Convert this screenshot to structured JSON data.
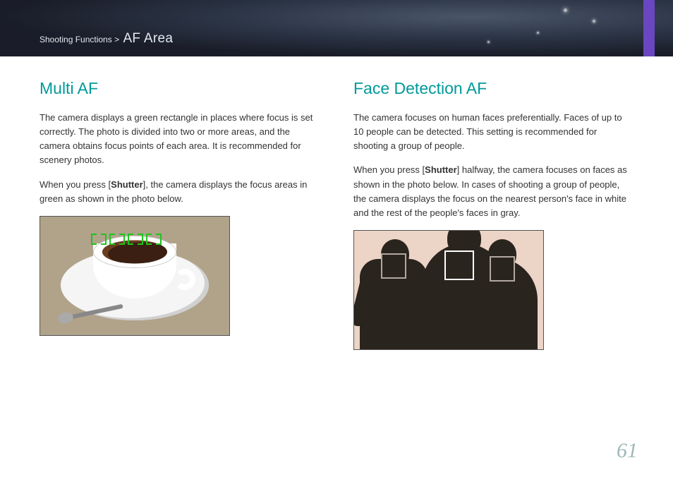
{
  "breadcrumb": {
    "parent": "Shooting Functions",
    "sep": ">",
    "section": "AF Area"
  },
  "left": {
    "heading": "Multi AF",
    "para1": "The camera displays a green rectangle in places where focus is set correctly. The photo is divided into two or more areas, and the camera obtains focus points of each area. It is recommended for scenery photos.",
    "para2_pre": "When you press [",
    "para2_btn": "Shutter",
    "para2_post": "], the camera displays the focus areas in green as shown in the photo below."
  },
  "right": {
    "heading": "Face Detection AF",
    "para1": "The camera focuses on human faces preferentially. Faces of up to 10 people can be detected. This setting is recommended for shooting a group of people.",
    "para2_pre": "When you press [",
    "para2_btn": "Shutter",
    "para2_post": "] halfway, the camera focuses on faces as shown in the photo below. In cases of shooting a group of people, the camera displays the focus on the nearest person's face in white and the rest of the people's faces in gray."
  },
  "page_number": "61"
}
